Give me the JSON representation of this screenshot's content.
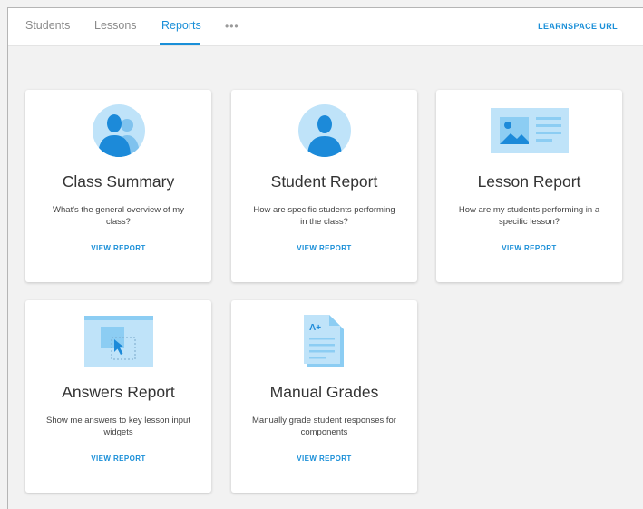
{
  "tabs": [
    {
      "label": "Students",
      "active": false
    },
    {
      "label": "Lessons",
      "active": false
    },
    {
      "label": "Reports",
      "active": true
    }
  ],
  "more_label": "•••",
  "learnspace_url_label": "LEARNSPACE URL",
  "colors": {
    "accent": "#1a8fd8",
    "icon_light": "#bfe3f9",
    "icon_dark": "#1c8ad9"
  },
  "cards": [
    {
      "title": "Class Summary",
      "description": "What's the general overview of my class?",
      "link": "VIEW REPORT",
      "icon": "group-users-icon"
    },
    {
      "title": "Student Report",
      "description": "How are specific students performing in the class?",
      "link": "VIEW REPORT",
      "icon": "user-icon"
    },
    {
      "title": "Lesson Report",
      "description": "How are my students performing in a specific lesson?",
      "link": "VIEW REPORT",
      "icon": "lesson-content-icon"
    },
    {
      "title": "Answers Report",
      "description": "Show me answers to key lesson input widgets",
      "link": "VIEW REPORT",
      "icon": "cursor-select-icon"
    },
    {
      "title": "Manual Grades",
      "description": "Manually grade student responses for components",
      "link": "VIEW REPORT",
      "icon": "graded-document-icon",
      "icon_text": "A+"
    }
  ]
}
